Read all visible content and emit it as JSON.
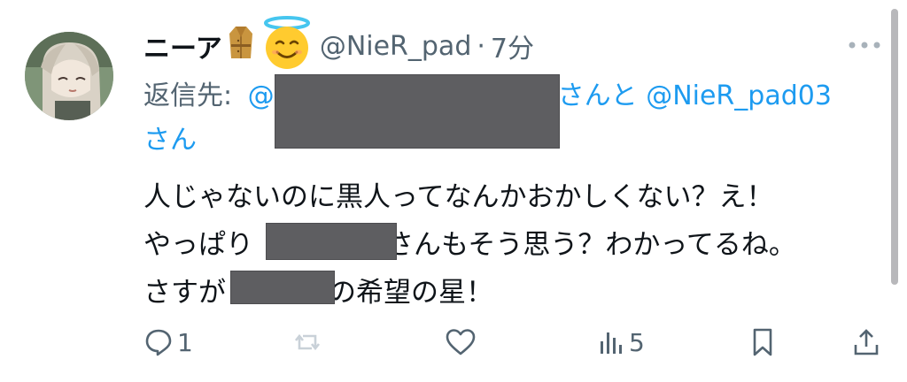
{
  "tweet": {
    "display_name": "ニーア",
    "handle": "@NieR_pad",
    "separator": "·",
    "time": "7分",
    "reply_prefix": "返信先:",
    "reply_link_start": "@",
    "reply_mid": "さんと",
    "reply_user2": "@NieR_pad03",
    "reply_suffix": "さん",
    "body": {
      "line1": "人じゃないのに黒人ってなんかおかしくない？え！",
      "line2_start": "やっぱり",
      "line2_end": "さんもそう思う？わかってるね。",
      "line3_start": "さすが",
      "line3_end": "の希望の星！"
    },
    "icons": {
      "badge1": "coat-icon",
      "badge2": "halo-smiley-icon",
      "more": "more-dots-icon"
    }
  },
  "actions": {
    "reply_count": "1",
    "repost_count": "",
    "like_count": "",
    "views_count": "5"
  },
  "colors": {
    "link": "#1d9bf0",
    "muted": "#536471",
    "redaction": "#5e5e61"
  }
}
